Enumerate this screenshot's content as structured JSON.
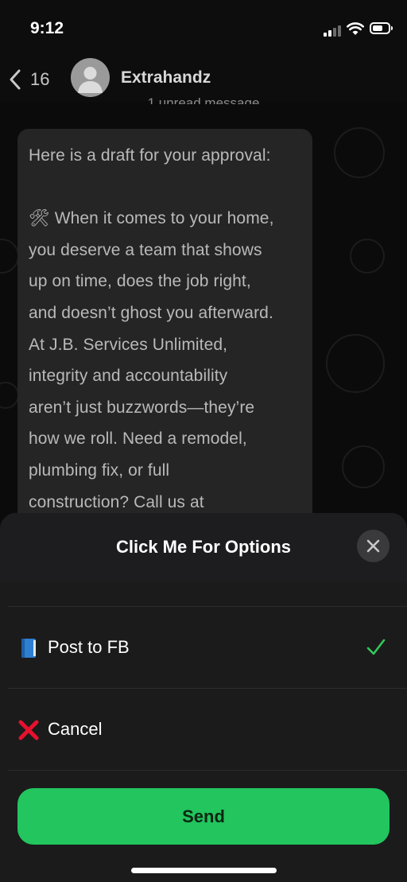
{
  "status_bar": {
    "time": "9:12"
  },
  "nav": {
    "back_count": "16",
    "contact_name": "Extrahandz",
    "unread_label": "1 unread message"
  },
  "message": {
    "intro": "Here is a draft for your approval:",
    "body_lines": [
      "🛠 When it comes to your home,",
      "you deserve a team that shows",
      "up on time, does the job right,",
      "and doesn’t ghost you afterward.",
      "At J.B. Services Unlimited,",
      "integrity and accountability",
      "aren’t just buzzwords—they’re",
      "how we roll. Need a remodel,",
      "plumbing fix, or full",
      "construction? Call us at"
    ]
  },
  "sheet": {
    "title": "Click Me For Options",
    "options": [
      {
        "label": "Post to FB",
        "icon": "blue-book-icon",
        "selected": true
      },
      {
        "label": "Cancel",
        "icon": "red-cross-icon",
        "selected": false
      }
    ],
    "send_label": "Send"
  },
  "colors": {
    "accent_green": "#22c55e",
    "check_green": "#34c759",
    "cancel_red": "#e8112d",
    "book_blue": "#2f7fd1"
  }
}
